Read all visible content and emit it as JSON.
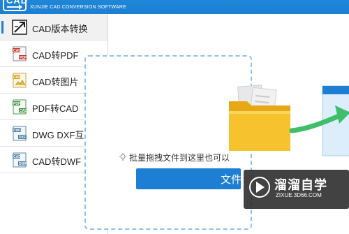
{
  "header": {
    "logo_text": "CAD",
    "subtitle": "XUNJIE CAD CONVERSION SOFTWARE",
    "banner_color": "#1f86d8"
  },
  "sidebar": {
    "items": [
      {
        "label": "CAD版本转换",
        "icon": "cad-version-icon",
        "active": true
      },
      {
        "label": "CAD转PDF",
        "icon": "cad-to-pdf-icon",
        "active": false
      },
      {
        "label": "CAD转图片",
        "icon": "cad-to-image-icon",
        "active": false
      },
      {
        "label": "PDF转CAD",
        "icon": "pdf-to-cad-icon",
        "active": false
      },
      {
        "label": "DWG DXF互转",
        "icon": "dwg-dxf-icon",
        "active": false
      },
      {
        "label": "CAD转DWF",
        "icon": "cad-to-dwf-icon",
        "active": false
      }
    ]
  },
  "main": {
    "hint": "批量拖拽文件到这里也可以",
    "add_button_label": "文件",
    "accent_color": "#1d7fd3"
  },
  "watermark": {
    "title": "溜溜自学",
    "url": "ZIXUE.3D66.COM"
  }
}
